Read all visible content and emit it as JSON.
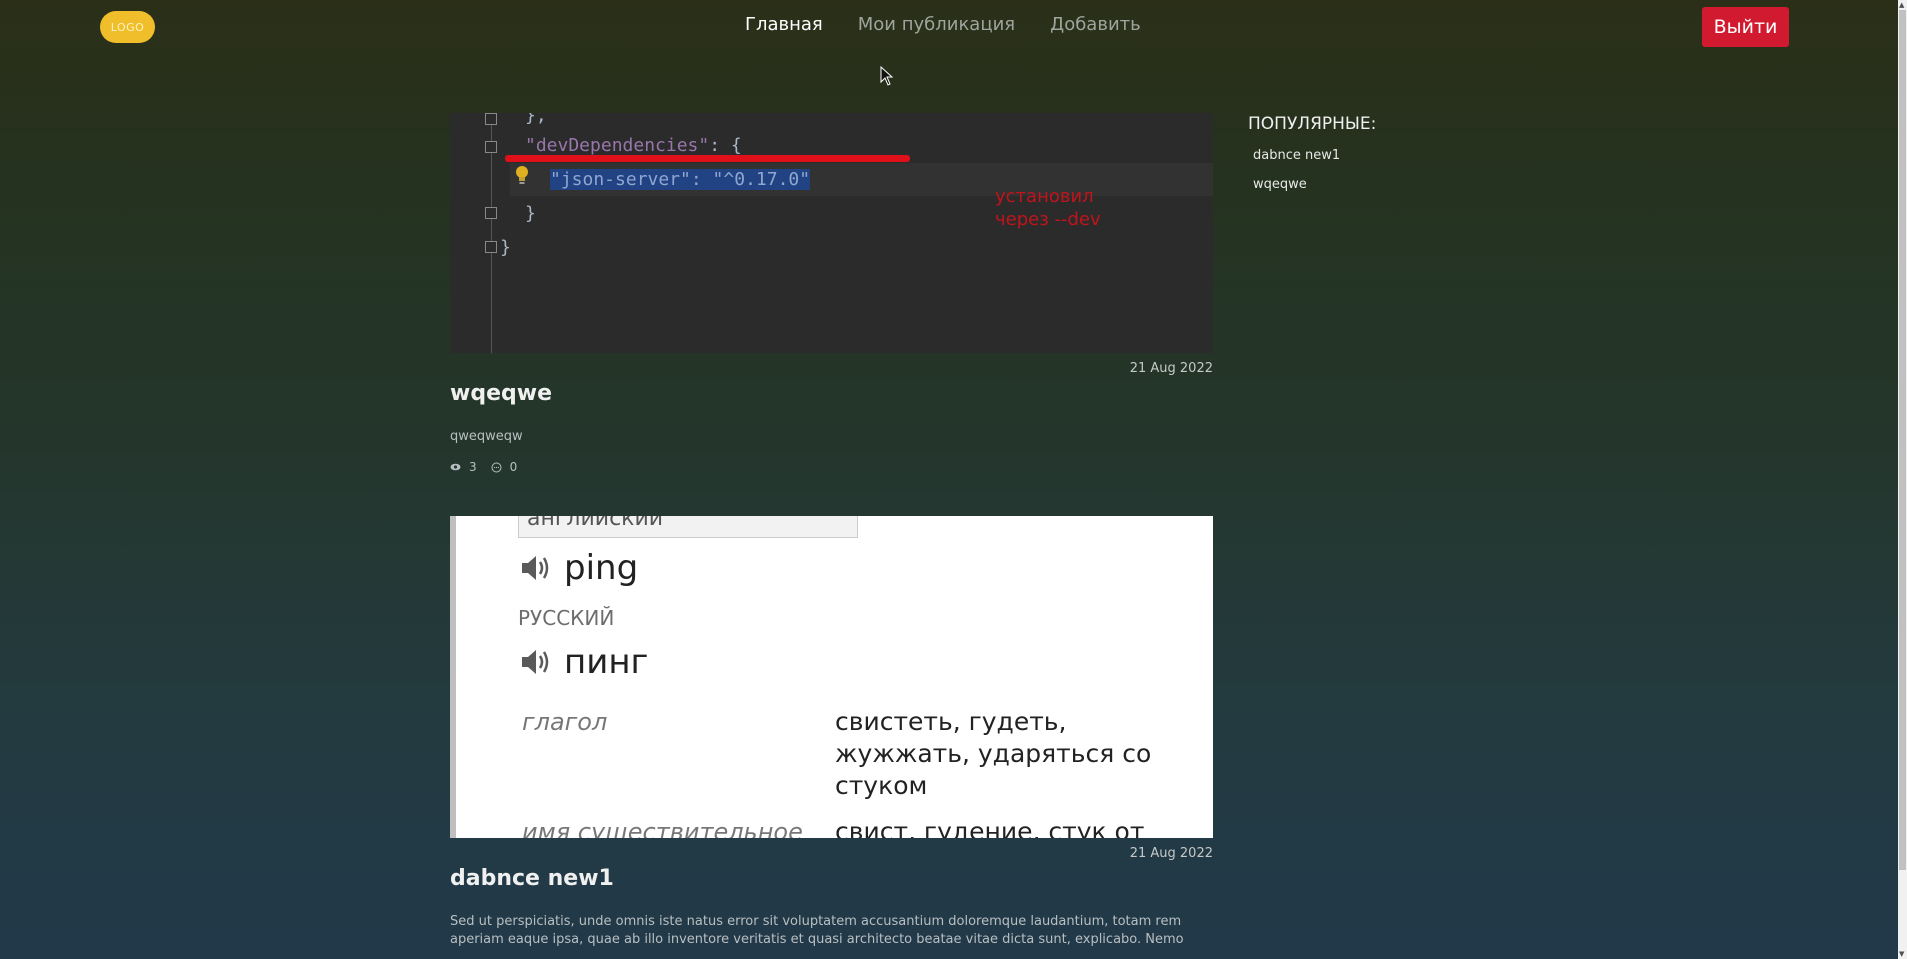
{
  "header": {
    "logo_text": "LOGO",
    "nav": [
      {
        "label": "Главная",
        "active": true
      },
      {
        "label": "Мои публикация",
        "active": false
      },
      {
        "label": "Добавить",
        "active": false
      }
    ],
    "logout_label": "Выйти"
  },
  "posts": [
    {
      "date": "21 Aug 2022",
      "title": "wqeqwe",
      "body": "qweqweqw",
      "views": "3",
      "comments": "0",
      "image": {
        "kind": "code-screenshot",
        "line0": "},",
        "key": "\"devDependencies\"",
        "brace_open": "{",
        "selected": "\"json-server\": \"^0.17.0\"",
        "brace_close_inner": "}",
        "brace_close_outer": "}",
        "annotation_line1": "установил",
        "annotation_line2": "через --dev"
      }
    },
    {
      "date": "21 Aug 2022",
      "title": "dabnce new1",
      "body": "Sed ut perspiciatis, unde omnis iste natus error sit voluptatem accusantium doloremque laudantium, totam rem aperiam eaque ipsa, quae ab illo inventore veritatis et quasi architecto beatae vitae dicta sunt, explicabo. Nemo enim ipsam voluptatem, quia voluptas sit, aspernatur aut odit aut fugit, sed quia consequuntur magni dolores eos, qui ratione",
      "image": {
        "kind": "dictionary-screenshot",
        "select_value": "английский",
        "word_en": "ping",
        "lang_label": "РУССКИЙ",
        "word_ru": "пинг",
        "pos1": "глагол",
        "trans1": "свистеть, гудеть, жужжать, ударяться со стуком",
        "pos2": "имя существительное",
        "trans2": "свист, гудение, стук от"
      }
    }
  ],
  "sidebar": {
    "title": "ПОПУЛЯРНЫЕ:",
    "items": [
      "dabnce new1",
      "wqeqwe"
    ]
  },
  "colors": {
    "logo": "#f0be2a",
    "logout": "#d11a2f",
    "annotation": "#c0141c"
  }
}
